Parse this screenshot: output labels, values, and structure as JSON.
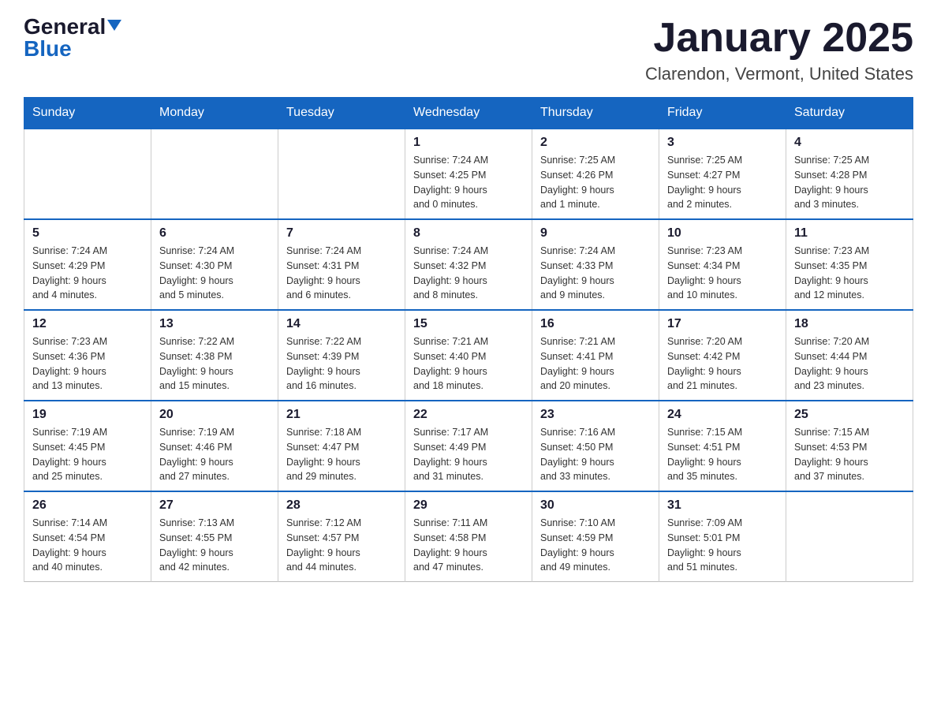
{
  "logo": {
    "general": "General",
    "blue": "Blue"
  },
  "title": "January 2025",
  "subtitle": "Clarendon, Vermont, United States",
  "days_of_week": [
    "Sunday",
    "Monday",
    "Tuesday",
    "Wednesday",
    "Thursday",
    "Friday",
    "Saturday"
  ],
  "weeks": [
    [
      {
        "day": "",
        "info": ""
      },
      {
        "day": "",
        "info": ""
      },
      {
        "day": "",
        "info": ""
      },
      {
        "day": "1",
        "info": "Sunrise: 7:24 AM\nSunset: 4:25 PM\nDaylight: 9 hours\nand 0 minutes."
      },
      {
        "day": "2",
        "info": "Sunrise: 7:25 AM\nSunset: 4:26 PM\nDaylight: 9 hours\nand 1 minute."
      },
      {
        "day": "3",
        "info": "Sunrise: 7:25 AM\nSunset: 4:27 PM\nDaylight: 9 hours\nand 2 minutes."
      },
      {
        "day": "4",
        "info": "Sunrise: 7:25 AM\nSunset: 4:28 PM\nDaylight: 9 hours\nand 3 minutes."
      }
    ],
    [
      {
        "day": "5",
        "info": "Sunrise: 7:24 AM\nSunset: 4:29 PM\nDaylight: 9 hours\nand 4 minutes."
      },
      {
        "day": "6",
        "info": "Sunrise: 7:24 AM\nSunset: 4:30 PM\nDaylight: 9 hours\nand 5 minutes."
      },
      {
        "day": "7",
        "info": "Sunrise: 7:24 AM\nSunset: 4:31 PM\nDaylight: 9 hours\nand 6 minutes."
      },
      {
        "day": "8",
        "info": "Sunrise: 7:24 AM\nSunset: 4:32 PM\nDaylight: 9 hours\nand 8 minutes."
      },
      {
        "day": "9",
        "info": "Sunrise: 7:24 AM\nSunset: 4:33 PM\nDaylight: 9 hours\nand 9 minutes."
      },
      {
        "day": "10",
        "info": "Sunrise: 7:23 AM\nSunset: 4:34 PM\nDaylight: 9 hours\nand 10 minutes."
      },
      {
        "day": "11",
        "info": "Sunrise: 7:23 AM\nSunset: 4:35 PM\nDaylight: 9 hours\nand 12 minutes."
      }
    ],
    [
      {
        "day": "12",
        "info": "Sunrise: 7:23 AM\nSunset: 4:36 PM\nDaylight: 9 hours\nand 13 minutes."
      },
      {
        "day": "13",
        "info": "Sunrise: 7:22 AM\nSunset: 4:38 PM\nDaylight: 9 hours\nand 15 minutes."
      },
      {
        "day": "14",
        "info": "Sunrise: 7:22 AM\nSunset: 4:39 PM\nDaylight: 9 hours\nand 16 minutes."
      },
      {
        "day": "15",
        "info": "Sunrise: 7:21 AM\nSunset: 4:40 PM\nDaylight: 9 hours\nand 18 minutes."
      },
      {
        "day": "16",
        "info": "Sunrise: 7:21 AM\nSunset: 4:41 PM\nDaylight: 9 hours\nand 20 minutes."
      },
      {
        "day": "17",
        "info": "Sunrise: 7:20 AM\nSunset: 4:42 PM\nDaylight: 9 hours\nand 21 minutes."
      },
      {
        "day": "18",
        "info": "Sunrise: 7:20 AM\nSunset: 4:44 PM\nDaylight: 9 hours\nand 23 minutes."
      }
    ],
    [
      {
        "day": "19",
        "info": "Sunrise: 7:19 AM\nSunset: 4:45 PM\nDaylight: 9 hours\nand 25 minutes."
      },
      {
        "day": "20",
        "info": "Sunrise: 7:19 AM\nSunset: 4:46 PM\nDaylight: 9 hours\nand 27 minutes."
      },
      {
        "day": "21",
        "info": "Sunrise: 7:18 AM\nSunset: 4:47 PM\nDaylight: 9 hours\nand 29 minutes."
      },
      {
        "day": "22",
        "info": "Sunrise: 7:17 AM\nSunset: 4:49 PM\nDaylight: 9 hours\nand 31 minutes."
      },
      {
        "day": "23",
        "info": "Sunrise: 7:16 AM\nSunset: 4:50 PM\nDaylight: 9 hours\nand 33 minutes."
      },
      {
        "day": "24",
        "info": "Sunrise: 7:15 AM\nSunset: 4:51 PM\nDaylight: 9 hours\nand 35 minutes."
      },
      {
        "day": "25",
        "info": "Sunrise: 7:15 AM\nSunset: 4:53 PM\nDaylight: 9 hours\nand 37 minutes."
      }
    ],
    [
      {
        "day": "26",
        "info": "Sunrise: 7:14 AM\nSunset: 4:54 PM\nDaylight: 9 hours\nand 40 minutes."
      },
      {
        "day": "27",
        "info": "Sunrise: 7:13 AM\nSunset: 4:55 PM\nDaylight: 9 hours\nand 42 minutes."
      },
      {
        "day": "28",
        "info": "Sunrise: 7:12 AM\nSunset: 4:57 PM\nDaylight: 9 hours\nand 44 minutes."
      },
      {
        "day": "29",
        "info": "Sunrise: 7:11 AM\nSunset: 4:58 PM\nDaylight: 9 hours\nand 47 minutes."
      },
      {
        "day": "30",
        "info": "Sunrise: 7:10 AM\nSunset: 4:59 PM\nDaylight: 9 hours\nand 49 minutes."
      },
      {
        "day": "31",
        "info": "Sunrise: 7:09 AM\nSunset: 5:01 PM\nDaylight: 9 hours\nand 51 minutes."
      },
      {
        "day": "",
        "info": ""
      }
    ]
  ]
}
